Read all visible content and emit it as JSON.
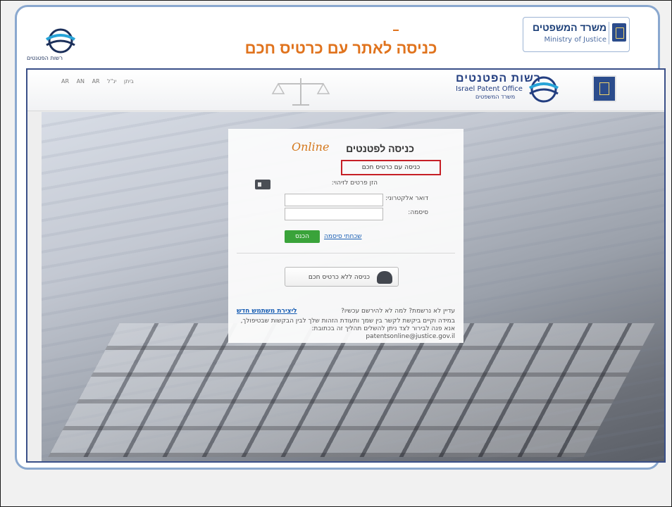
{
  "slide": {
    "title": "כניסה לאתר עם כרטיס חכם",
    "logo_text": "רשות הפטנטים",
    "ministry_he": "משרד המשפטים",
    "ministry_en": "Ministry of Justice"
  },
  "site_header": {
    "lang_links": "AR  AN  AR  ביתן  ינ\"ל",
    "office_he": "רשות הפטנטים",
    "office_en": "Israel Patent Office",
    "office_sub": "משרד המשפטים"
  },
  "login": {
    "title": "כניסה לפטנטים",
    "online": "Online",
    "smartcard_label": "כניסה עם כרטיס חכם",
    "fill_label": "הזן פרטים לזיהוי:",
    "email_label": "דואר אלקטרוני:",
    "password_label": "סיסמה:",
    "enter_button": "הכנס",
    "forgot_password": "שכחתי סיסמה",
    "no_card_button": "כניסה ללא כרטיס חכם",
    "not_registered": "עדיין לא נרשמת? למה לא להירשם עכשיו?",
    "register_link": "ליצירת משתמש חדש",
    "help_text": "במידה וקיים ביקשת לקשר בין שמך ותעודת הזהות שלך לבין הבקשות שבטיפולך, אנא פנה לבירור לצד ניתן להשלים תהליך זה בכתובת:",
    "help_email": "patentsonline@justice.gov.il"
  }
}
